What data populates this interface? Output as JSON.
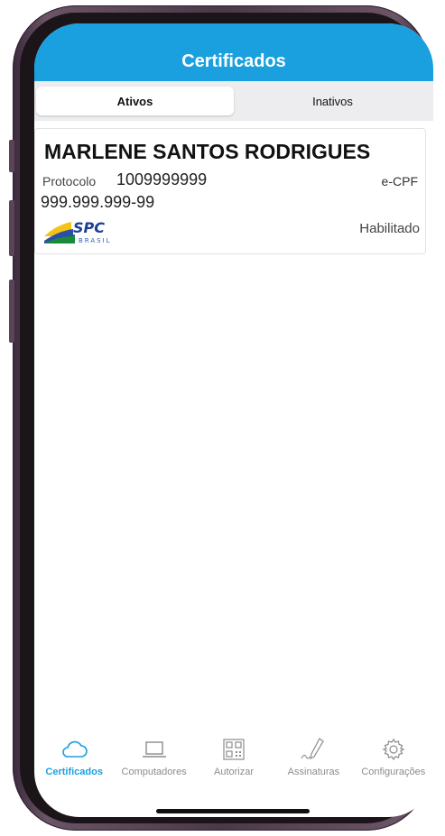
{
  "header": {
    "title": "Certificados"
  },
  "tabs": [
    {
      "label": "Ativos",
      "active": true
    },
    {
      "label": "Inativos",
      "active": false
    }
  ],
  "certificate": {
    "name": "MARLENE SANTOS RODRIGUES",
    "protocol_label": "Protocolo",
    "protocol_value": "1009999999",
    "document": "999.999.999-99",
    "type": "e-CPF",
    "status": "Habilitado",
    "issuer_logo": {
      "text": "SPC",
      "subtext": "BRASIL"
    }
  },
  "bottom_nav": [
    {
      "label": "Certificados",
      "icon": "cloud-icon",
      "active": true
    },
    {
      "label": "Computadores",
      "icon": "laptop-icon",
      "active": false
    },
    {
      "label": "Autorizar",
      "icon": "qr-code-icon",
      "active": false
    },
    {
      "label": "Assinaturas",
      "icon": "signature-pen-icon",
      "active": false
    },
    {
      "label": "Configurações",
      "icon": "gear-icon",
      "active": false
    }
  ],
  "colors": {
    "accent": "#1aa0df",
    "inactive": "#8c8c8c"
  }
}
